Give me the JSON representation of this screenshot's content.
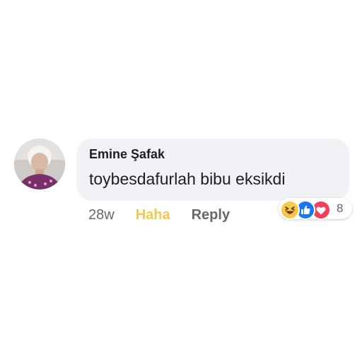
{
  "comment": {
    "author": "Emine Şafak",
    "text": "toybesdafurlah bibu eksikdi",
    "avatar_icon": "profile-photo"
  },
  "actions": {
    "timestamp": "28w",
    "haha_label": "Haha",
    "reply_label": "Reply"
  },
  "reactions": {
    "icons": [
      "haha-icon",
      "like-icon",
      "love-icon"
    ],
    "count": "8"
  },
  "colors": {
    "bubble": "#f0f2f5",
    "haha_active": "#f2c94c",
    "like": "#1877f2",
    "love": "#f33e58",
    "muted_text": "#65676b"
  }
}
